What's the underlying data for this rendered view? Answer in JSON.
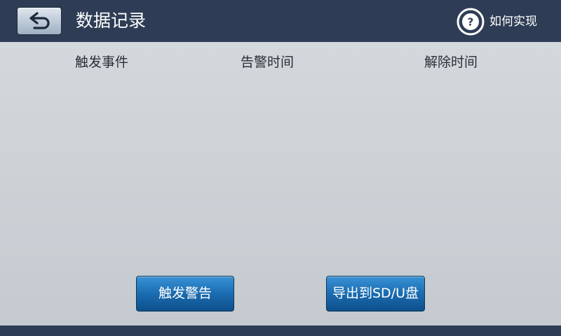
{
  "header": {
    "title": "数据记录",
    "help_label": "如何实现",
    "help_symbol": "?"
  },
  "table": {
    "columns": [
      "触发事件",
      "告警时间",
      "解除时间"
    ],
    "rows": []
  },
  "buttons": {
    "trigger_alarm": "触发警告",
    "export": "导出到SD/U盘"
  },
  "colors": {
    "header_bg": "#2e3d55",
    "content_bg": "#c9ced1",
    "button_blue": "#1b6cb0"
  }
}
